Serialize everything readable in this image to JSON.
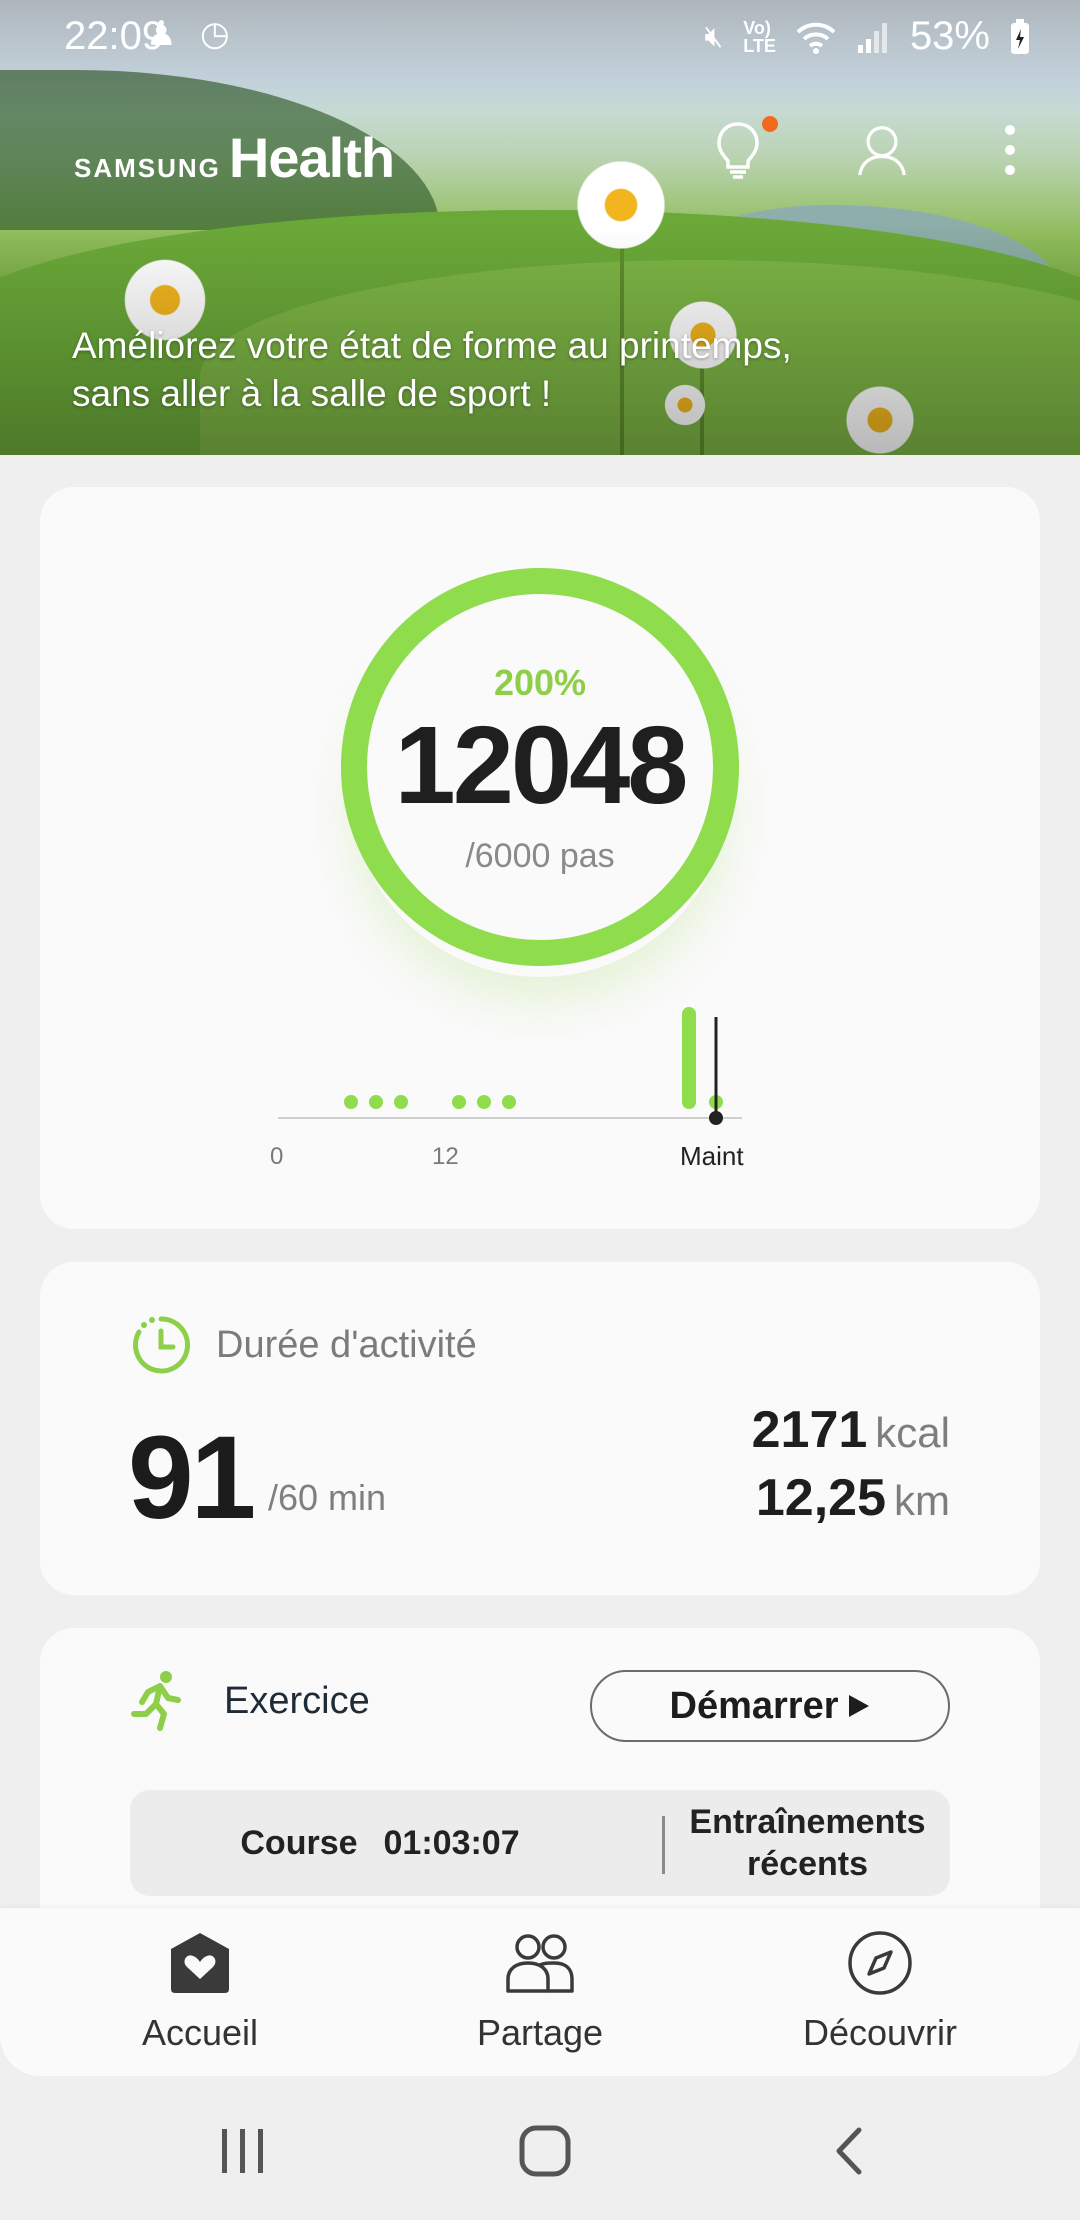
{
  "status_bar": {
    "time": "22:09",
    "battery": "53%",
    "icons": [
      "notification-icon",
      "clock-icon",
      "mute-icon",
      "volte-icon",
      "wifi-icon",
      "signal-icon",
      "battery-icon"
    ]
  },
  "header": {
    "brand_small": "SAMSUNG",
    "brand_large": "Health",
    "hero_message_line1": "Améliorez votre état de forme au printemps,",
    "hero_message_line2": "sans aller à la salle de sport !",
    "icons": [
      "tips-lightbulb-icon",
      "profile-icon",
      "more-options-icon"
    ],
    "notification_dot_color": "#f26a1b"
  },
  "steps": {
    "percent": "200%",
    "count": "12048",
    "goal": "/6000 pas",
    "ring_color": "#8fdc4d",
    "progress_fraction": 1.0,
    "chart": {
      "x_labels": [
        "0",
        "12",
        "Maint"
      ]
    }
  },
  "activity": {
    "title": "Durée d'activité",
    "value": "91",
    "goal": "/60 min",
    "calories": "2171",
    "calories_unit": "kcal",
    "distance": "12,25",
    "distance_unit": "km",
    "accent_color": "#8dcf48"
  },
  "exercise": {
    "title": "Exercice",
    "start_label": "Démarrer",
    "last_activity": "Course",
    "last_duration": "01:03:07",
    "recent_line1": "Entraînements",
    "recent_line2": "récents"
  },
  "bottom_nav": {
    "items": [
      {
        "label": "Accueil",
        "icon": "home-heart-icon"
      },
      {
        "label": "Partage",
        "icon": "people-icon"
      },
      {
        "label": "Découvrir",
        "icon": "compass-icon"
      }
    ]
  },
  "system_nav": [
    "recent-apps-icon",
    "home-icon",
    "back-icon"
  ]
}
